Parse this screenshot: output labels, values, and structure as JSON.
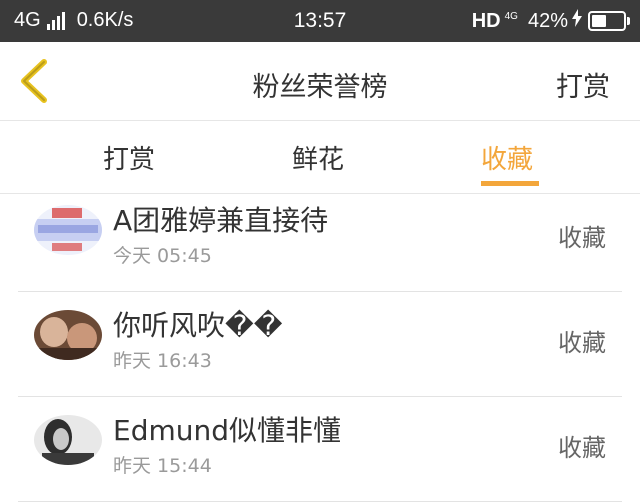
{
  "status_bar": {
    "network": "4G",
    "speed": "0.6K/s",
    "time": "13:57",
    "hd_label": "HD",
    "hd_network": "4G",
    "battery_percent": "42%",
    "battery_level": 0.42
  },
  "header": {
    "title": "粉丝荣誉榜",
    "action_label": "打赏",
    "back_icon": "chevron-left-icon",
    "accent_color": "#f3a63b"
  },
  "tabs": [
    {
      "label": "打赏",
      "active": false
    },
    {
      "label": "鲜花",
      "active": false
    },
    {
      "label": "收藏",
      "active": true
    }
  ],
  "list": [
    {
      "name": "A团雅婷兼直接待",
      "time": "今天 05:45",
      "action": "收藏"
    },
    {
      "name": "你听风吹��",
      "time": "昨天 16:43",
      "action": "收藏"
    },
    {
      "name": "Edmund似懂非懂",
      "time": "昨天 15:44",
      "action": "收藏"
    }
  ]
}
